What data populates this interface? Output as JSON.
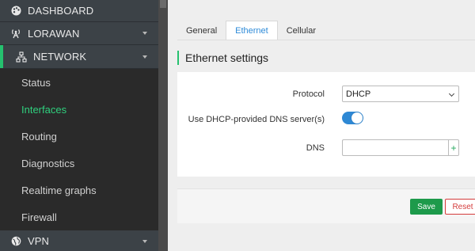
{
  "sidebar": {
    "dashboard": {
      "label": "DASHBOARD",
      "icon": "palette-icon"
    },
    "lorawan": {
      "label": "LORAWAN",
      "icon": "antenna-icon"
    },
    "network": {
      "label": "NETWORK",
      "icon": "network-icon"
    },
    "network_items": [
      {
        "label": "Status"
      },
      {
        "label": "Interfaces"
      },
      {
        "label": "Routing"
      },
      {
        "label": "Diagnostics"
      },
      {
        "label": "Realtime graphs"
      },
      {
        "label": "Firewall"
      }
    ],
    "vpn": {
      "label": "VPN",
      "icon": "globe-icon"
    },
    "active_item": "Interfaces"
  },
  "tabs": [
    {
      "label": "General"
    },
    {
      "label": "Ethernet"
    },
    {
      "label": "Cellular"
    }
  ],
  "active_tab": "Ethernet",
  "section": {
    "title": "Ethernet settings"
  },
  "form": {
    "protocol_label": "Protocol",
    "protocol_value": "DHCP",
    "dns_provided_label": "Use DHCP-provided DNS server(s)",
    "dns_provided_enabled": true,
    "dns_label": "DNS",
    "dns_value": "",
    "dns_add_symbol": "+"
  },
  "actions": {
    "save_label": "Save",
    "reset_label": "Reset"
  },
  "colors": {
    "accent_green": "#25c16f",
    "tab_blue": "#2e8bd8",
    "save_green": "#1d9a4b",
    "reset_red": "#d43c3c",
    "toggle_blue": "#2e88d4"
  }
}
